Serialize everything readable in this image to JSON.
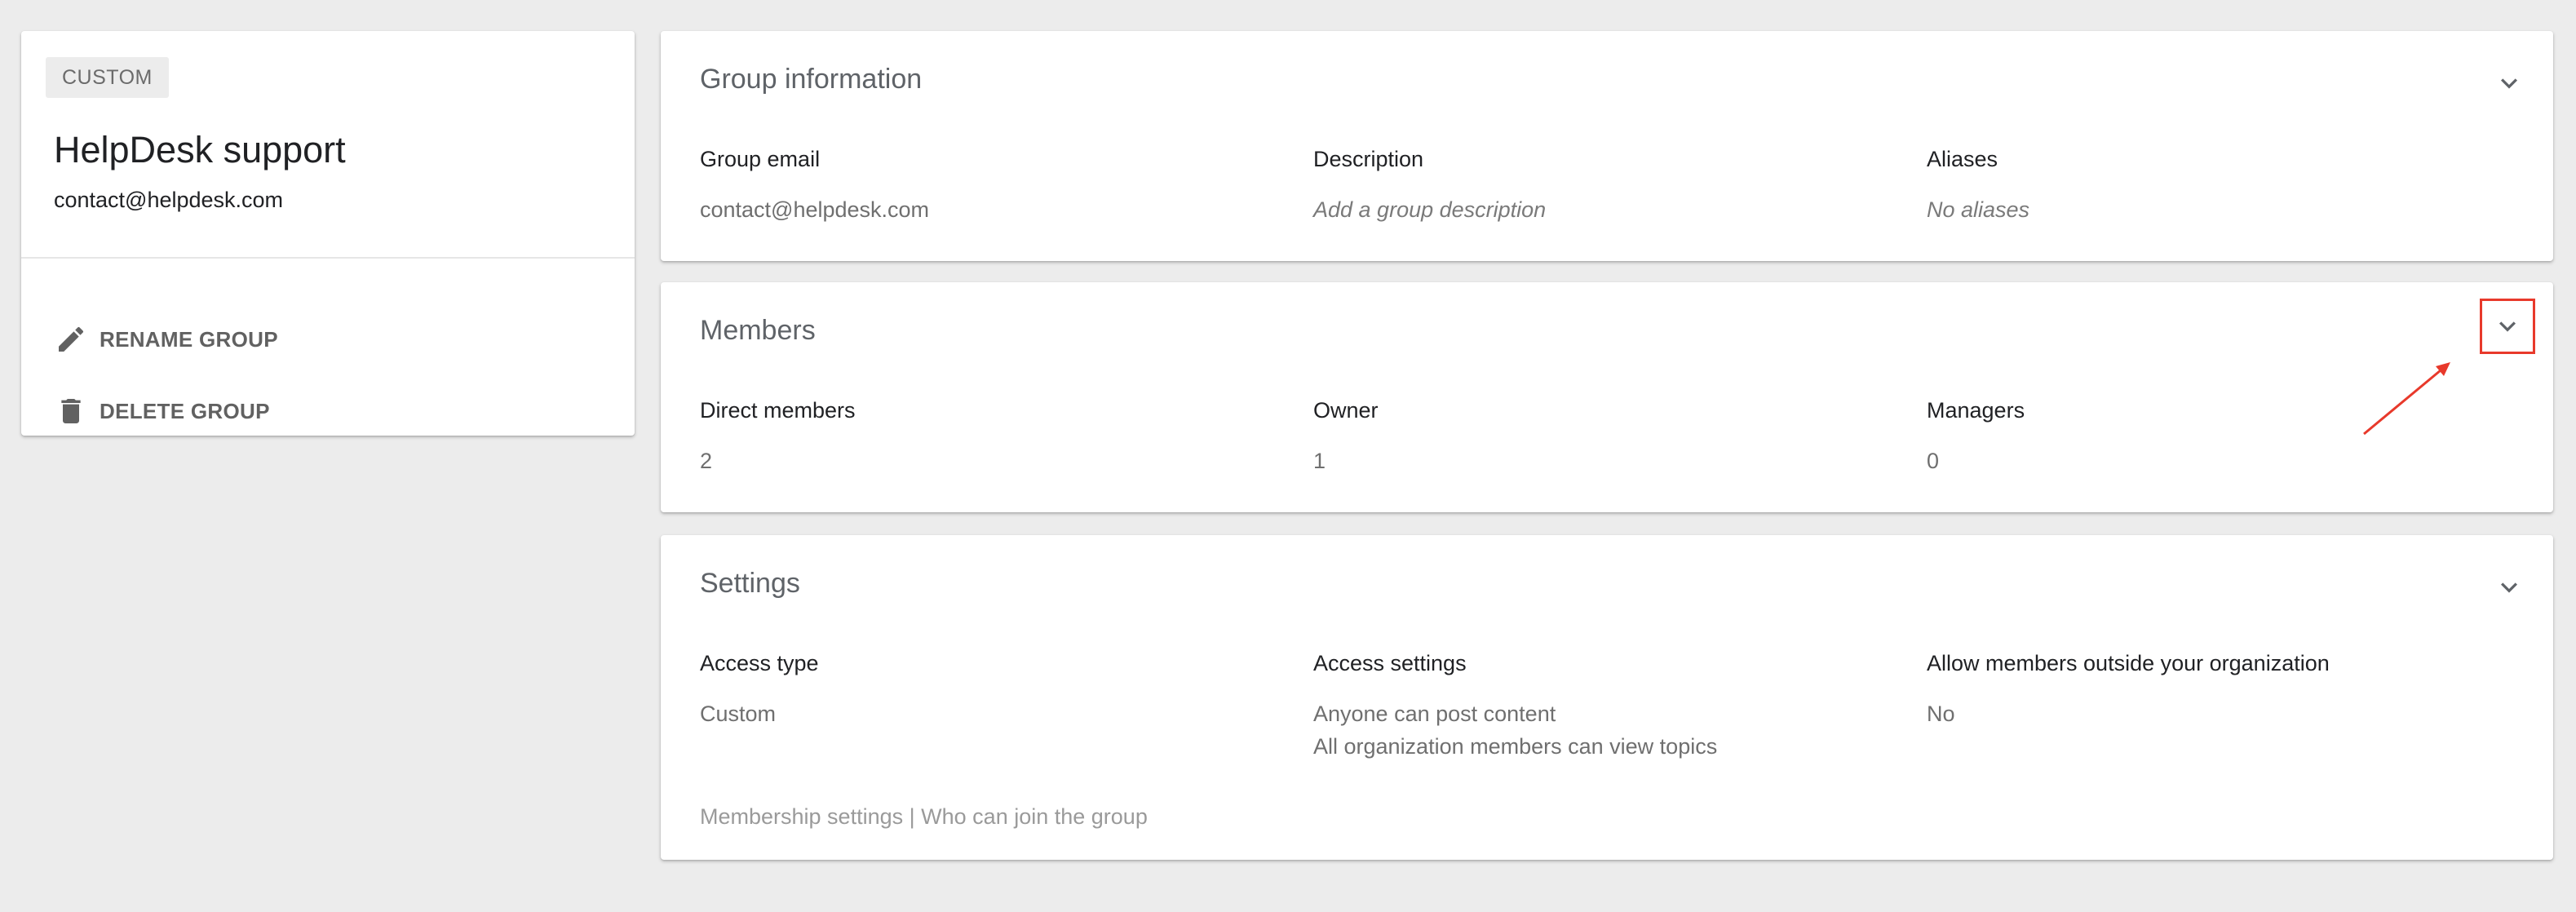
{
  "group_card": {
    "type_badge": "CUSTOM",
    "name": "HelpDesk support",
    "email": "contact@helpdesk.com",
    "actions": [
      {
        "label": "RENAME GROUP",
        "icon": "pencil-icon"
      },
      {
        "label": "DELETE GROUP",
        "icon": "trash-icon"
      }
    ]
  },
  "sections": {
    "group_information": {
      "title": "Group information",
      "fields": [
        {
          "label": "Group email",
          "value": "contact@helpdesk.com"
        },
        {
          "label": "Description",
          "value": "Add a group description"
        },
        {
          "label": "Aliases",
          "value": "No aliases"
        }
      ]
    },
    "members": {
      "title": "Members",
      "fields": [
        {
          "label": "Direct members",
          "value": "2"
        },
        {
          "label": "Owner",
          "value": "1"
        },
        {
          "label": "Managers",
          "value": "0"
        }
      ]
    },
    "settings": {
      "title": "Settings",
      "fields": [
        {
          "label": "Access type",
          "values": [
            "Custom"
          ]
        },
        {
          "label": "Access settings",
          "values": [
            "Anyone can post content",
            "All organization members can view topics"
          ]
        },
        {
          "label": "Allow members outside your organization",
          "values": [
            "No"
          ]
        }
      ],
      "footer": {
        "membership_link": "Membership settings",
        "separator": "|",
        "join_link": "Who can join the group"
      }
    }
  },
  "colors": {
    "background": "#ececec",
    "card": "#ffffff",
    "annotation": "#e8392b"
  }
}
